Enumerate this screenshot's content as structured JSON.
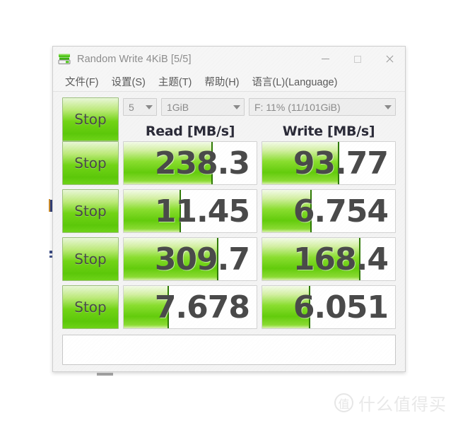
{
  "window": {
    "title": "Random Write 4KiB [5/5]",
    "icon": "disk-drive-icon",
    "controls": {
      "minimize": "minimize-icon",
      "maximize": "maximize-icon",
      "close": "close-icon"
    }
  },
  "menu": {
    "items": [
      {
        "label": "文件(F)"
      },
      {
        "label": "设置(S)"
      },
      {
        "label": "主题(T)"
      },
      {
        "label": "帮助(H)"
      },
      {
        "label": "语言(L)(Language)"
      }
    ]
  },
  "toolbar": {
    "all_button_label": "Stop",
    "test_count": "5",
    "test_size": "1GiB",
    "drive": "F: 11% (11/101GiB)"
  },
  "headers": {
    "blank": "",
    "read": "Read [MB/s]",
    "write": "Write [MB/s]"
  },
  "rows": [
    {
      "button_label": "Stop",
      "read_value": "238.3",
      "read_fill_pct": 66,
      "write_value": "93.77",
      "write_fill_pct": 57
    },
    {
      "button_label": "Stop",
      "read_value": "11.45",
      "read_fill_pct": 42,
      "write_value": "6.754",
      "write_fill_pct": 36
    },
    {
      "button_label": "Stop",
      "read_value": "309.7",
      "read_fill_pct": 70,
      "write_value": "168.4",
      "write_fill_pct": 73
    },
    {
      "button_label": "Stop",
      "read_value": "7.678",
      "read_fill_pct": 33,
      "write_value": "6.051",
      "write_fill_pct": 35
    }
  ],
  "comment": {
    "value": "",
    "placeholder": ""
  },
  "watermark": {
    "logo_char": "值",
    "text": "什么值得买"
  },
  "colors": {
    "accent_green": "#63cc0c",
    "bar_edge": "#2f7a06",
    "value_text": "#4a4a4a",
    "header_text": "#2b2b38",
    "title_text": "#8d8d8d"
  }
}
